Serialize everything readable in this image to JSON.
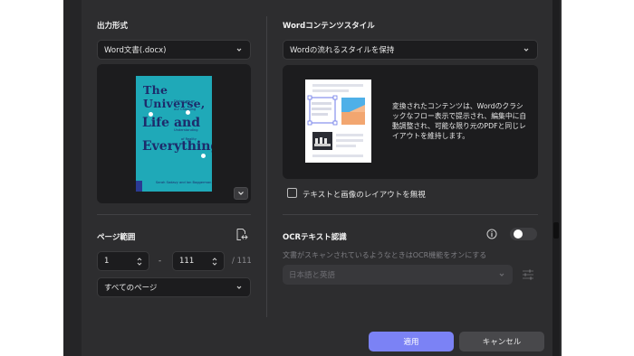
{
  "output_format": {
    "title": "出力形式",
    "selected": "Word文書(.docx)",
    "book": {
      "title_line1": "The Universe,",
      "title_line2": "Life and",
      "title_line3": "Everything",
      "subtitle1": "Dialogues on",
      "subtitle2": "our Changing",
      "subtitle3": "Understanding",
      "subtitle4": "of Reality",
      "author": "Sarah Sadavy and Ian Baggerman"
    }
  },
  "word_style": {
    "title": "Wordコンテンツスタイル",
    "selected": "Wordの流れるスタイルを保持",
    "description": "変換されたコンテンツは、Wordのクラシックなフロー表示で提示され、編集中に自動調整され、可能な限り元のPDFと同じレイアウトを維持します。",
    "ignore_layout_label": "テキストと画像のレイアウトを無視"
  },
  "page_range": {
    "title": "ページ範囲",
    "from": "1",
    "separator": "-",
    "to": "111",
    "total": "/ 111",
    "subset": "すべてのページ"
  },
  "ocr": {
    "title": "OCRテキスト認識",
    "hint": "文書がスキャンされているようなときはOCR機能をオンにする",
    "language": "日本語と英語",
    "enabled": false
  },
  "buttons": {
    "apply": "適用",
    "cancel": "キャンセル"
  },
  "colors": {
    "panel": "#2d2d2f",
    "accent": "#7b82f5",
    "book_cover": "#1fa9b8"
  }
}
